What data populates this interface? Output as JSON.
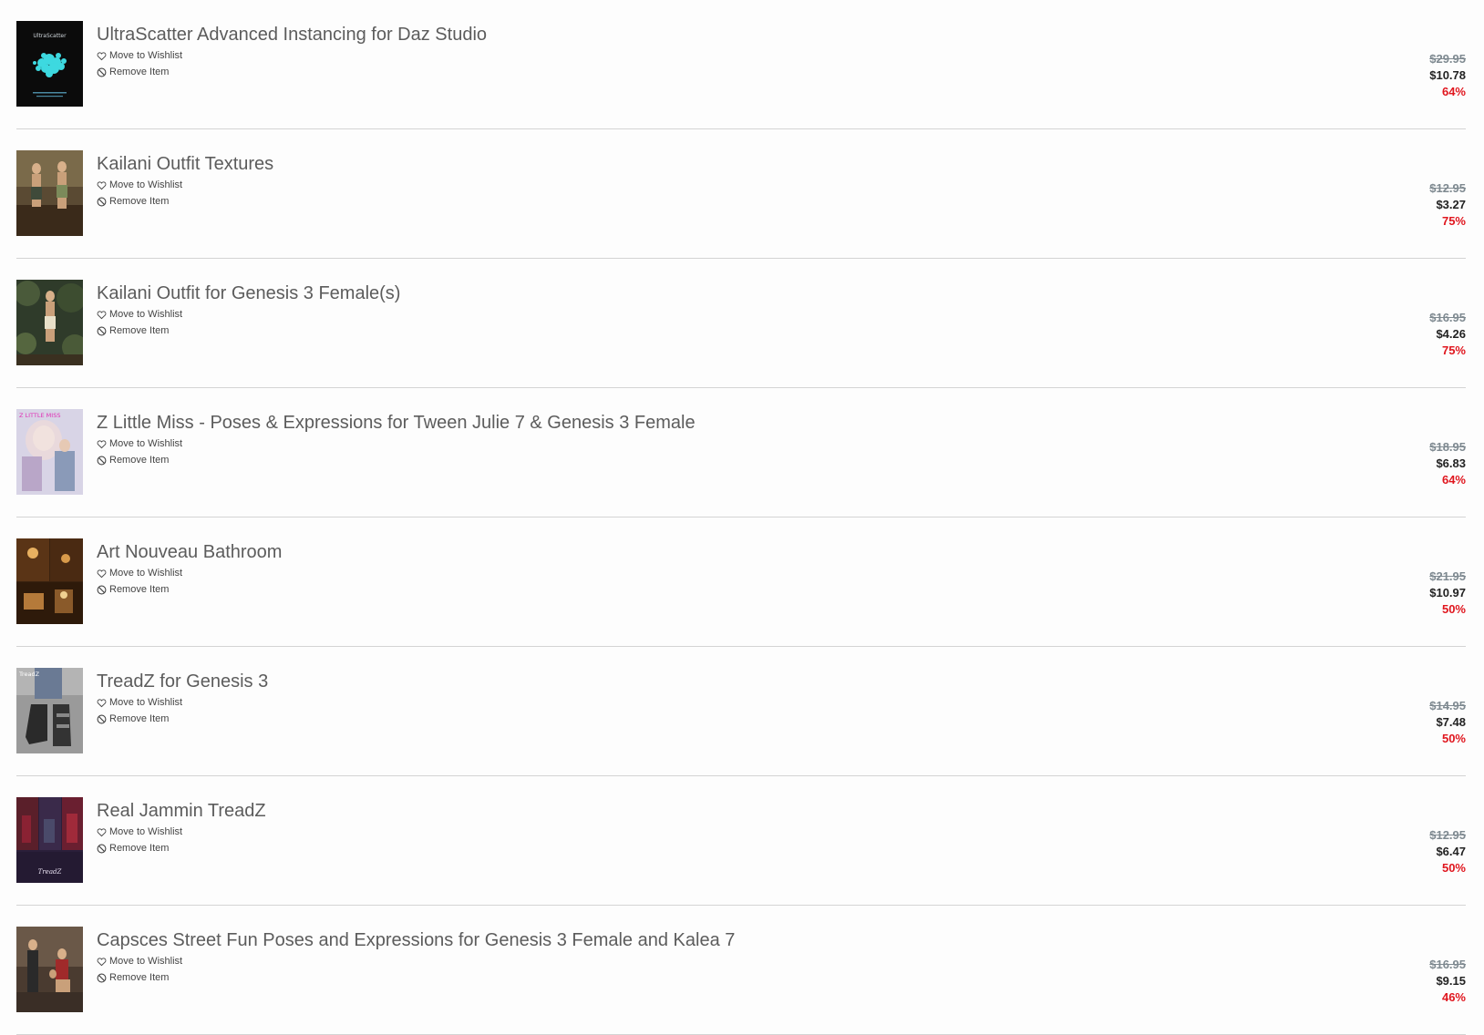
{
  "cart": {
    "items": [
      {
        "title": "UltraScatter Advanced Instancing for Daz Studio",
        "wishlist_label": "Move to Wishlist",
        "remove_label": "Remove Item",
        "original_price": "$29.95",
        "sale_price": "$10.78",
        "discount": "64%",
        "thumb_text": "UltraScatter",
        "thumb_colors": [
          "#0b0b0b",
          "#3dd9e0"
        ]
      },
      {
        "title": "Kailani Outfit Textures",
        "wishlist_label": "Move to Wishlist",
        "remove_label": "Remove Item",
        "original_price": "$12.95",
        "sale_price": "$3.27",
        "discount": "75%",
        "thumb_colors": [
          "#5a4a33",
          "#9a7b5a"
        ]
      },
      {
        "title": "Kailani Outfit for Genesis 3 Female(s)",
        "wishlist_label": "Move to Wishlist",
        "remove_label": "Remove Item",
        "original_price": "$16.95",
        "sale_price": "$4.26",
        "discount": "75%",
        "thumb_colors": [
          "#2f3b2a",
          "#6b7a55"
        ]
      },
      {
        "title": "Z Little Miss - Poses & Expressions for Tween Julie 7 & Genesis 3 Female",
        "wishlist_label": "Move to Wishlist",
        "remove_label": "Remove Item",
        "original_price": "$18.95",
        "sale_price": "$6.83",
        "discount": "64%",
        "thumb_text": "Z LITTLE MISS",
        "thumb_colors": [
          "#d8d4e6",
          "#b9a6c8"
        ]
      },
      {
        "title": "Art Nouveau Bathroom",
        "wishlist_label": "Move to Wishlist",
        "remove_label": "Remove Item",
        "original_price": "$21.95",
        "sale_price": "$10.97",
        "discount": "50%",
        "thumb_colors": [
          "#3a220f",
          "#b57a3a"
        ]
      },
      {
        "title": "TreadZ for Genesis 3",
        "wishlist_label": "Move to Wishlist",
        "remove_label": "Remove Item",
        "original_price": "$14.95",
        "sale_price": "$7.48",
        "discount": "50%",
        "thumb_text": "TreadZ",
        "thumb_colors": [
          "#9a9a9a",
          "#2a2a2a"
        ]
      },
      {
        "title": "Real Jammin TreadZ",
        "wishlist_label": "Move to Wishlist",
        "remove_label": "Remove Item",
        "original_price": "$12.95",
        "sale_price": "$6.47",
        "discount": "50%",
        "thumb_text": "TreadZ",
        "thumb_colors": [
          "#2a1f3a",
          "#8a2233"
        ]
      },
      {
        "title": "Capsces Street Fun Poses and Expressions for Genesis 3 Female and Kalea 7",
        "wishlist_label": "Move to Wishlist",
        "remove_label": "Remove Item",
        "original_price": "$16.95",
        "sale_price": "$9.15",
        "discount": "46%",
        "thumb_colors": [
          "#4a3b30",
          "#a0826a"
        ]
      }
    ]
  },
  "icons": {
    "wishlist": "heart-icon",
    "remove": "ban-icon"
  },
  "colors": {
    "discount": "#e0161e",
    "original_price": "#7e8990",
    "sale_price": "#222222",
    "title": "#5c5c5c",
    "divider": "#d4d4d4"
  }
}
